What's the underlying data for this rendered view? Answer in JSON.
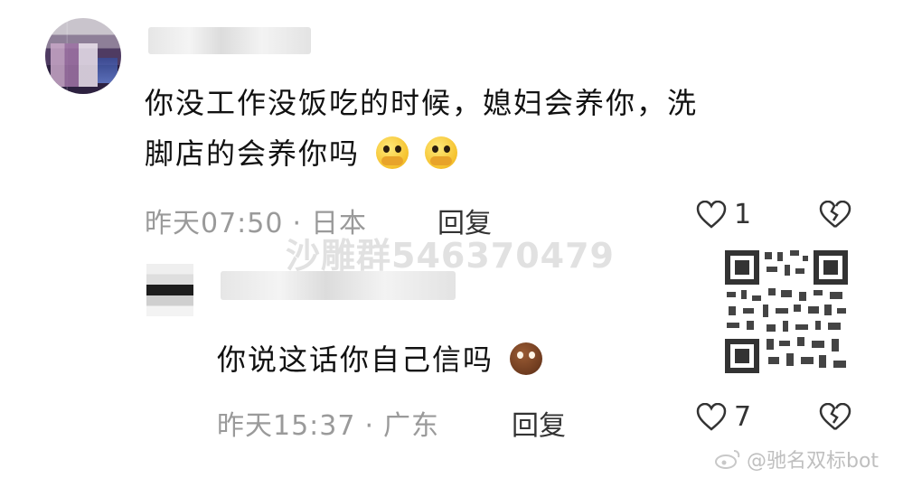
{
  "comment1": {
    "text_line1": "你没工作没饭吃的时候，媳妇会养你，洗",
    "text_line2": "脚店的会养你吗",
    "emoji": "pleading-covering-mouth-emoji",
    "time": "昨天07:50",
    "location": "日本",
    "reply_label": "回复",
    "likes": "1"
  },
  "watermark": "沙雕群546370479",
  "comment2": {
    "text": "你说这话你自己信吗",
    "emoji": "smirk-bean-emoji",
    "time": "昨天15:37",
    "location": "广东",
    "reply_label": "回复",
    "likes": "7"
  },
  "footer": {
    "weibo_watermark": "@驰名双标bot"
  },
  "colors": {
    "text": "#111111",
    "meta": "#9a9a9a"
  }
}
